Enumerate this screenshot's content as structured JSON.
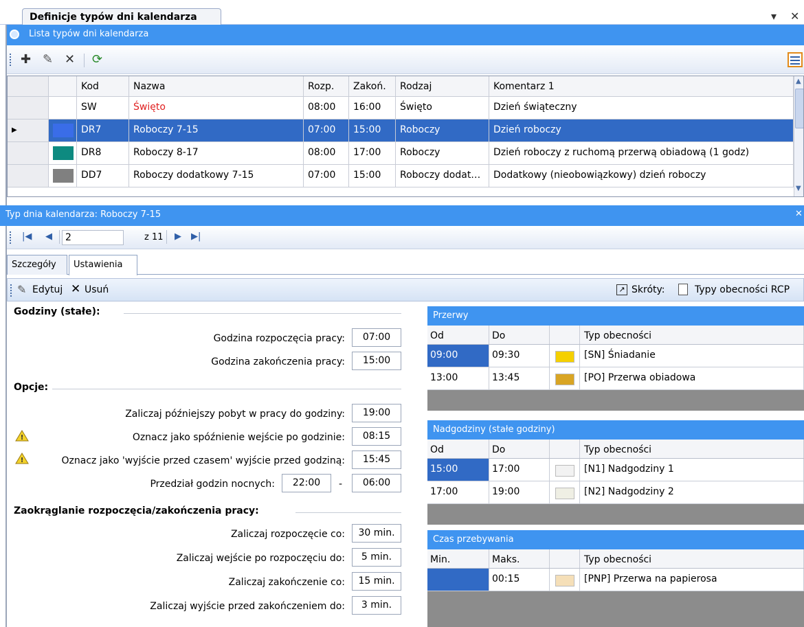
{
  "window": {
    "tab_title": "Definicje typów dni kalendarza",
    "pin": "▾",
    "close": "✕"
  },
  "list": {
    "title": "Lista typów dni kalendarza"
  },
  "toolbar": {
    "add": "✚",
    "edit": "✎",
    "delete": "✕",
    "refresh": "⟳"
  },
  "grid": {
    "columns": [
      "Kod",
      "Nazwa",
      "Rozp.",
      "Zakoń.",
      "Rodzaj",
      "Komentarz 1"
    ],
    "rows": [
      {
        "kod": "SW",
        "nazwa": "Święto",
        "rozp": "08:00",
        "zakon": "16:00",
        "rodzaj": "Święto",
        "komentarz": "Dzień świąteczny",
        "color": "#ffffff",
        "name_color": "#e02020"
      },
      {
        "kod": "DR7",
        "nazwa": "Roboczy 7-15",
        "rozp": "07:00",
        "zakon": "15:00",
        "rodzaj": "Roboczy",
        "komentarz": "Dzień roboczy",
        "color": "#3a6de8",
        "selected": true
      },
      {
        "kod": "DR8",
        "nazwa": "Roboczy 8-17",
        "rozp": "08:00",
        "zakon": "17:00",
        "rodzaj": "Roboczy",
        "komentarz": "Dzień roboczy z ruchomą przerwą obiadową (1 godz)",
        "color": "#0d8a80"
      },
      {
        "kod": "DD7",
        "nazwa": "Roboczy dodatkowy 7-15",
        "rozp": "07:00",
        "zakon": "15:00",
        "rodzaj": "Roboczy dodat…",
        "komentarz": "Dodatkowy (nieobowiązkowy) dzień roboczy",
        "color": "#808080"
      }
    ]
  },
  "detail": {
    "title": "Typ dnia kalendarza: Roboczy 7-15",
    "close": "✕"
  },
  "nav": {
    "position": "2",
    "total_label": "z 11"
  },
  "tabs": {
    "details": "Szczegóły",
    "settings": "Ustawienia"
  },
  "edit_toolbar": {
    "edit": "Edytuj",
    "delete": "Usuń",
    "shortcuts": "Skróty:",
    "rcp": "Typy obecności RCP"
  },
  "settings": {
    "hours_section": "Godziny (stałe):",
    "start_label": "Godzina rozpoczęcia pracy:",
    "start_value": "07:00",
    "end_label": "Godzina zakończenia pracy:",
    "end_value": "15:00",
    "options_section": "Opcje:",
    "later_label": "Zaliczaj późniejszy pobyt w pracy do godziny:",
    "later_value": "19:00",
    "late_label": "Oznacz jako spóźnienie wejście po godzinie:",
    "late_value": "08:15",
    "early_label": "Oznacz jako 'wyjście przed czasem' wyjście przed godziną:",
    "early_value": "15:45",
    "night_label": "Przedział godzin nocnych:",
    "night_from": "22:00",
    "night_sep": "-",
    "night_to": "06:00",
    "rounding_section": "Zaokrąglanie rozpoczęcia/zakończenia pracy:",
    "r1_label": "Zaliczaj rozpoczęcie co:",
    "r1_value": "30 min.",
    "r2_label": "Zaliczaj wejście po rozpoczęciu do:",
    "r2_value": "5 min.",
    "r3_label": "Zaliczaj zakończenie co:",
    "r3_value": "15 min.",
    "r4_label": "Zaliczaj wyjście przed zakończeniem do:",
    "r4_value": "3 min."
  },
  "breaks": {
    "title": "Przerwy",
    "col_from": "Od",
    "col_to": "Do",
    "col_type": "Typ obecności",
    "rows": [
      {
        "from": "09:00",
        "to": "09:30",
        "type": "[SN] Śniadanie",
        "color": "#f5d000"
      },
      {
        "from": "13:00",
        "to": "13:45",
        "type": "[PO] Przerwa obiadowa",
        "color": "#d9a524"
      }
    ]
  },
  "overtime": {
    "title": "Nadgodziny (stałe godziny)",
    "col_from": "Od",
    "col_to": "Do",
    "col_type": "Typ obecności",
    "rows": [
      {
        "from": "15:00",
        "to": "17:00",
        "type": "[N1] Nadgodziny 1",
        "color": "#f2f2f2"
      },
      {
        "from": "17:00",
        "to": "19:00",
        "type": "[N2] Nadgodziny 2",
        "color": "#efefe4"
      }
    ]
  },
  "presence": {
    "title": "Czas przebywania",
    "col_min": "Min.",
    "col_max": "Maks.",
    "col_type": "Typ obecności",
    "rows": [
      {
        "min": "",
        "max": "00:15",
        "type": "[PNP] Przerwa na papierosa",
        "color": "#f5dfb8"
      }
    ]
  }
}
